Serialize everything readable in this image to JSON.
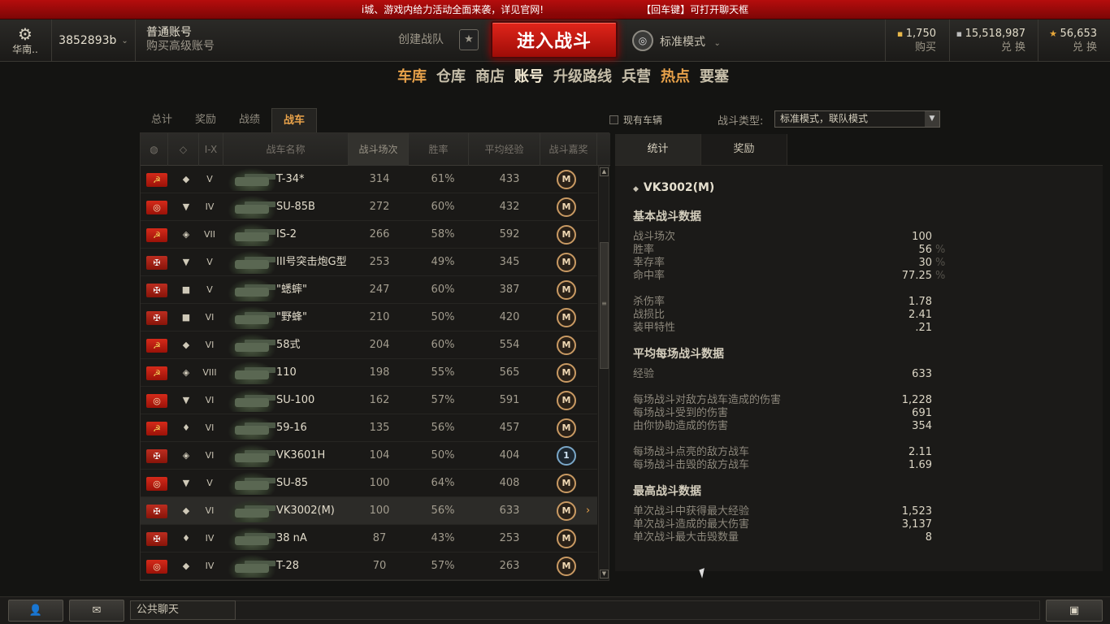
{
  "banner": {
    "left": "i城、游戏内给力活动全面来袭，详见官网!",
    "right": "【回车键】可打开聊天框"
  },
  "topbar": {
    "server": "华南..",
    "account_name": "3852893b",
    "account_type": "普通账号",
    "buy_premium": "购买高级账号",
    "create_team": "创建战队",
    "enter_battle": "进入战斗",
    "battle_mode": "标准模式",
    "gold": {
      "value": "1,750",
      "label": "购买"
    },
    "credits": {
      "value": "15,518,987",
      "label": "兑 换"
    },
    "free_xp": {
      "value": "56,653",
      "label": "兑 换"
    }
  },
  "nav": [
    "车库",
    "仓库",
    "商店",
    "账号",
    "升级路线",
    "兵营",
    "热点",
    "要塞"
  ],
  "subtabs": [
    "总计",
    "奖励",
    "战绩",
    "战车"
  ],
  "filter": {
    "owned_label": "现有车辆",
    "battle_type_label": "战斗类型:",
    "battle_type_value": "标准模式，联队模式"
  },
  "table": {
    "headers": {
      "tier": "I-X",
      "name": "战车名称",
      "battles": "战斗场次",
      "winrate": "胜率",
      "avg_xp": "平均经验",
      "mastery": "战斗嘉奖"
    },
    "rows": [
      {
        "flag": "ussr",
        "type": "◆",
        "tier": "V",
        "name": "T-34*",
        "battles": "314",
        "win": "61%",
        "xp": "433",
        "medal": "M"
      },
      {
        "flag": "china",
        "type": "▼",
        "tier": "IV",
        "name": "SU-85B",
        "battles": "272",
        "win": "60%",
        "xp": "432",
        "medal": "M"
      },
      {
        "flag": "ussr",
        "type": "◈",
        "tier": "VII",
        "name": "IS-2",
        "battles": "266",
        "win": "58%",
        "xp": "592",
        "medal": "M"
      },
      {
        "flag": "ger",
        "type": "▼",
        "tier": "V",
        "name": "III号突击炮G型",
        "battles": "253",
        "win": "49%",
        "xp": "345",
        "medal": "M"
      },
      {
        "flag": "ger",
        "type": "■",
        "tier": "V",
        "name": "\"蟋蟀\"",
        "battles": "247",
        "win": "60%",
        "xp": "387",
        "medal": "M"
      },
      {
        "flag": "ger",
        "type": "■",
        "tier": "VI",
        "name": "\"野蜂\"",
        "battles": "210",
        "win": "50%",
        "xp": "420",
        "medal": "M"
      },
      {
        "flag": "ussr",
        "type": "◆",
        "tier": "VI",
        "name": "58式",
        "battles": "204",
        "win": "60%",
        "xp": "554",
        "medal": "M"
      },
      {
        "flag": "ussr",
        "type": "◈",
        "tier": "VIII",
        "name": "110",
        "battles": "198",
        "win": "55%",
        "xp": "565",
        "medal": "M"
      },
      {
        "flag": "china",
        "type": "▼",
        "tier": "VI",
        "name": "SU-100",
        "battles": "162",
        "win": "57%",
        "xp": "591",
        "medal": "M"
      },
      {
        "flag": "ussr",
        "type": "♦",
        "tier": "VI",
        "name": "59-16",
        "battles": "135",
        "win": "56%",
        "xp": "457",
        "medal": "M"
      },
      {
        "flag": "ger",
        "type": "◈",
        "tier": "VI",
        "name": "VK3601H",
        "battles": "104",
        "win": "50%",
        "xp": "404",
        "medal": "1"
      },
      {
        "flag": "china",
        "type": "▼",
        "tier": "V",
        "name": "SU-85",
        "battles": "100",
        "win": "64%",
        "xp": "408",
        "medal": "M"
      },
      {
        "flag": "ger",
        "type": "◆",
        "tier": "VI",
        "name": "VK3002(M)",
        "battles": "100",
        "win": "56%",
        "xp": "633",
        "medal": "M",
        "selected": true
      },
      {
        "flag": "ger",
        "type": "♦",
        "tier": "IV",
        "name": "38 nA",
        "battles": "87",
        "win": "43%",
        "xp": "253",
        "medal": "M"
      },
      {
        "flag": "china",
        "type": "◆",
        "tier": "IV",
        "name": "T-28",
        "battles": "70",
        "win": "57%",
        "xp": "263",
        "medal": "M"
      }
    ]
  },
  "right_tabs": [
    "统计",
    "奖励"
  ],
  "detail": {
    "vehicle": "VK3002(M)",
    "basic_title": "基本战斗数据",
    "basic": [
      {
        "label": "战斗场次",
        "value": "100",
        "unit": ""
      },
      {
        "label": "胜率",
        "value": "56",
        "unit": "%"
      },
      {
        "label": "幸存率",
        "value": "30",
        "unit": "%"
      },
      {
        "label": "命中率",
        "value": "77.25",
        "unit": "%"
      }
    ],
    "ratio": [
      {
        "label": "杀伤率",
        "value": "1.78"
      },
      {
        "label": "战损比",
        "value": "2.41"
      },
      {
        "label": "装甲特性",
        "value": ".21"
      }
    ],
    "avg_title": "平均每场战斗数据",
    "avg_xp": {
      "label": "经验",
      "value": "633"
    },
    "avg_dmg": [
      {
        "label": "每场战斗对敌方战车造成的伤害",
        "value": "1,228"
      },
      {
        "label": "每场战斗受到的伤害",
        "value": "691"
      },
      {
        "label": "由你协助造成的伤害",
        "value": "354"
      }
    ],
    "avg_spot": [
      {
        "label": "每场战斗点亮的敌方战车",
        "value": "2.11"
      },
      {
        "label": "每场战斗击毁的敌方战车",
        "value": "1.69"
      }
    ],
    "max_title": "最高战斗数据",
    "max": [
      {
        "label": "单次战斗中获得最大经验",
        "value": "1,523"
      },
      {
        "label": "单次战斗造成的最大伤害",
        "value": "3,137"
      },
      {
        "label": "单次战斗最大击毁数量",
        "value": "8"
      }
    ]
  },
  "bottom": {
    "chat_label": "公共聊天"
  }
}
